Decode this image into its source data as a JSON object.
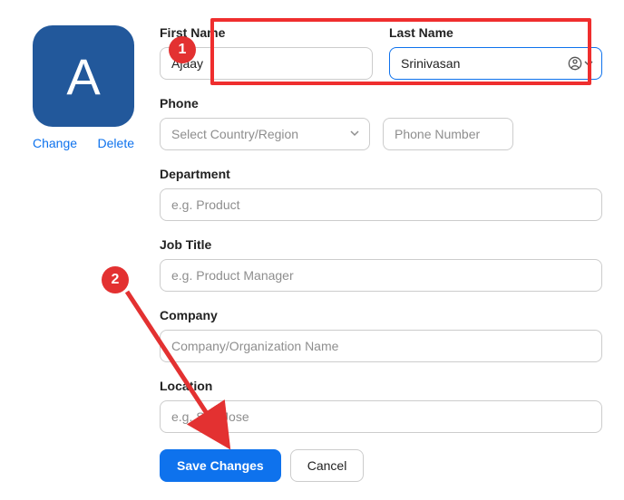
{
  "avatar": {
    "letter": "A",
    "change_label": "Change",
    "delete_label": "Delete"
  },
  "fields": {
    "first_name": {
      "label": "First Name",
      "value": "Ajaay"
    },
    "last_name": {
      "label": "Last Name",
      "value": "Srinivasan"
    },
    "phone": {
      "label": "Phone",
      "country_placeholder": "Select Country/Region",
      "number_placeholder": "Phone Number"
    },
    "department": {
      "label": "Department",
      "placeholder": "e.g. Product"
    },
    "job_title": {
      "label": "Job Title",
      "placeholder": "e.g. Product Manager"
    },
    "company": {
      "label": "Company",
      "placeholder": "Company/Organization Name"
    },
    "location": {
      "label": "Location",
      "placeholder": "e.g. San Jose"
    }
  },
  "actions": {
    "save": "Save Changes",
    "cancel": "Cancel"
  },
  "annotations": {
    "badge1": "1",
    "badge2": "2"
  },
  "colors": {
    "primary": "#0e72ed",
    "avatar_bg": "#22589b",
    "annotation": "#e33131"
  }
}
